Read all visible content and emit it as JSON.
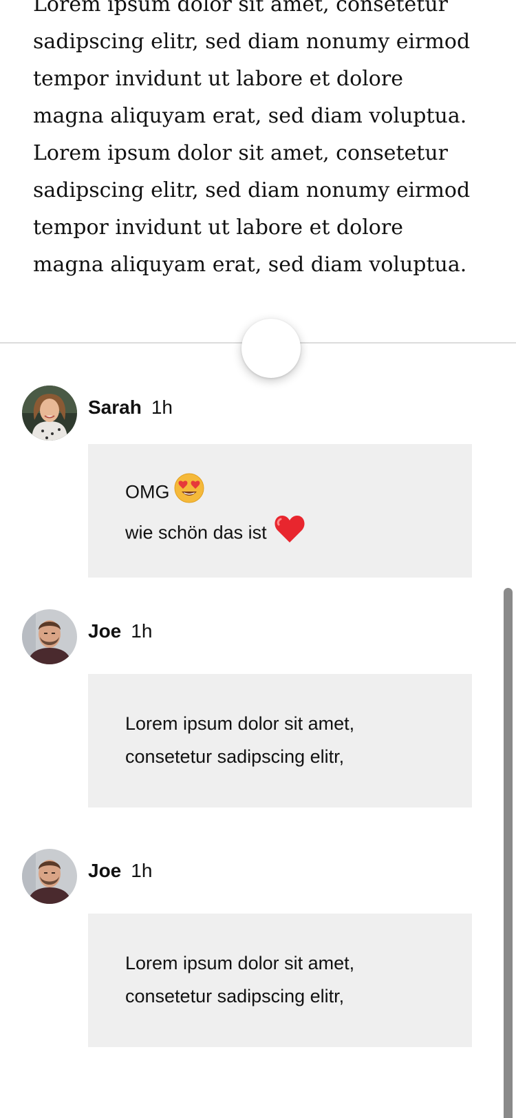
{
  "article": {
    "text": "Lorem ipsum dolor sit amet, consetetur sadipscing elitr, sed diam nonumy eirmod tempor invidunt ut labore et dolore magna aliquyam erat, sed diam voluptua. Lorem ipsum dolor sit amet, consetetur sadipscing elitr, sed diam nonumy eirmod tempor invidunt ut labore et dolore magna aliquyam erat, sed diam voluptua."
  },
  "comments": [
    {
      "author": "Sarah",
      "time": "1h",
      "lines": [
        "OMG",
        "wie schön das ist"
      ],
      "emojis": [
        "heart-eyes-emoji",
        "red-heart-emoji"
      ]
    },
    {
      "author": "Joe",
      "time": "1h",
      "lines": [
        "Lorem ipsum dolor sit amet,",
        "consetetur sadipscing elitr,"
      ]
    },
    {
      "author": "Joe",
      "time": "1h",
      "lines": [
        "Lorem ipsum dolor sit amet,",
        "consetetur sadipscing elitr,"
      ]
    }
  ],
  "colors": {
    "bubble_background": "#efefef",
    "divider": "#dcdcdc",
    "scrollbar_thumb": "#8a8a8a"
  }
}
